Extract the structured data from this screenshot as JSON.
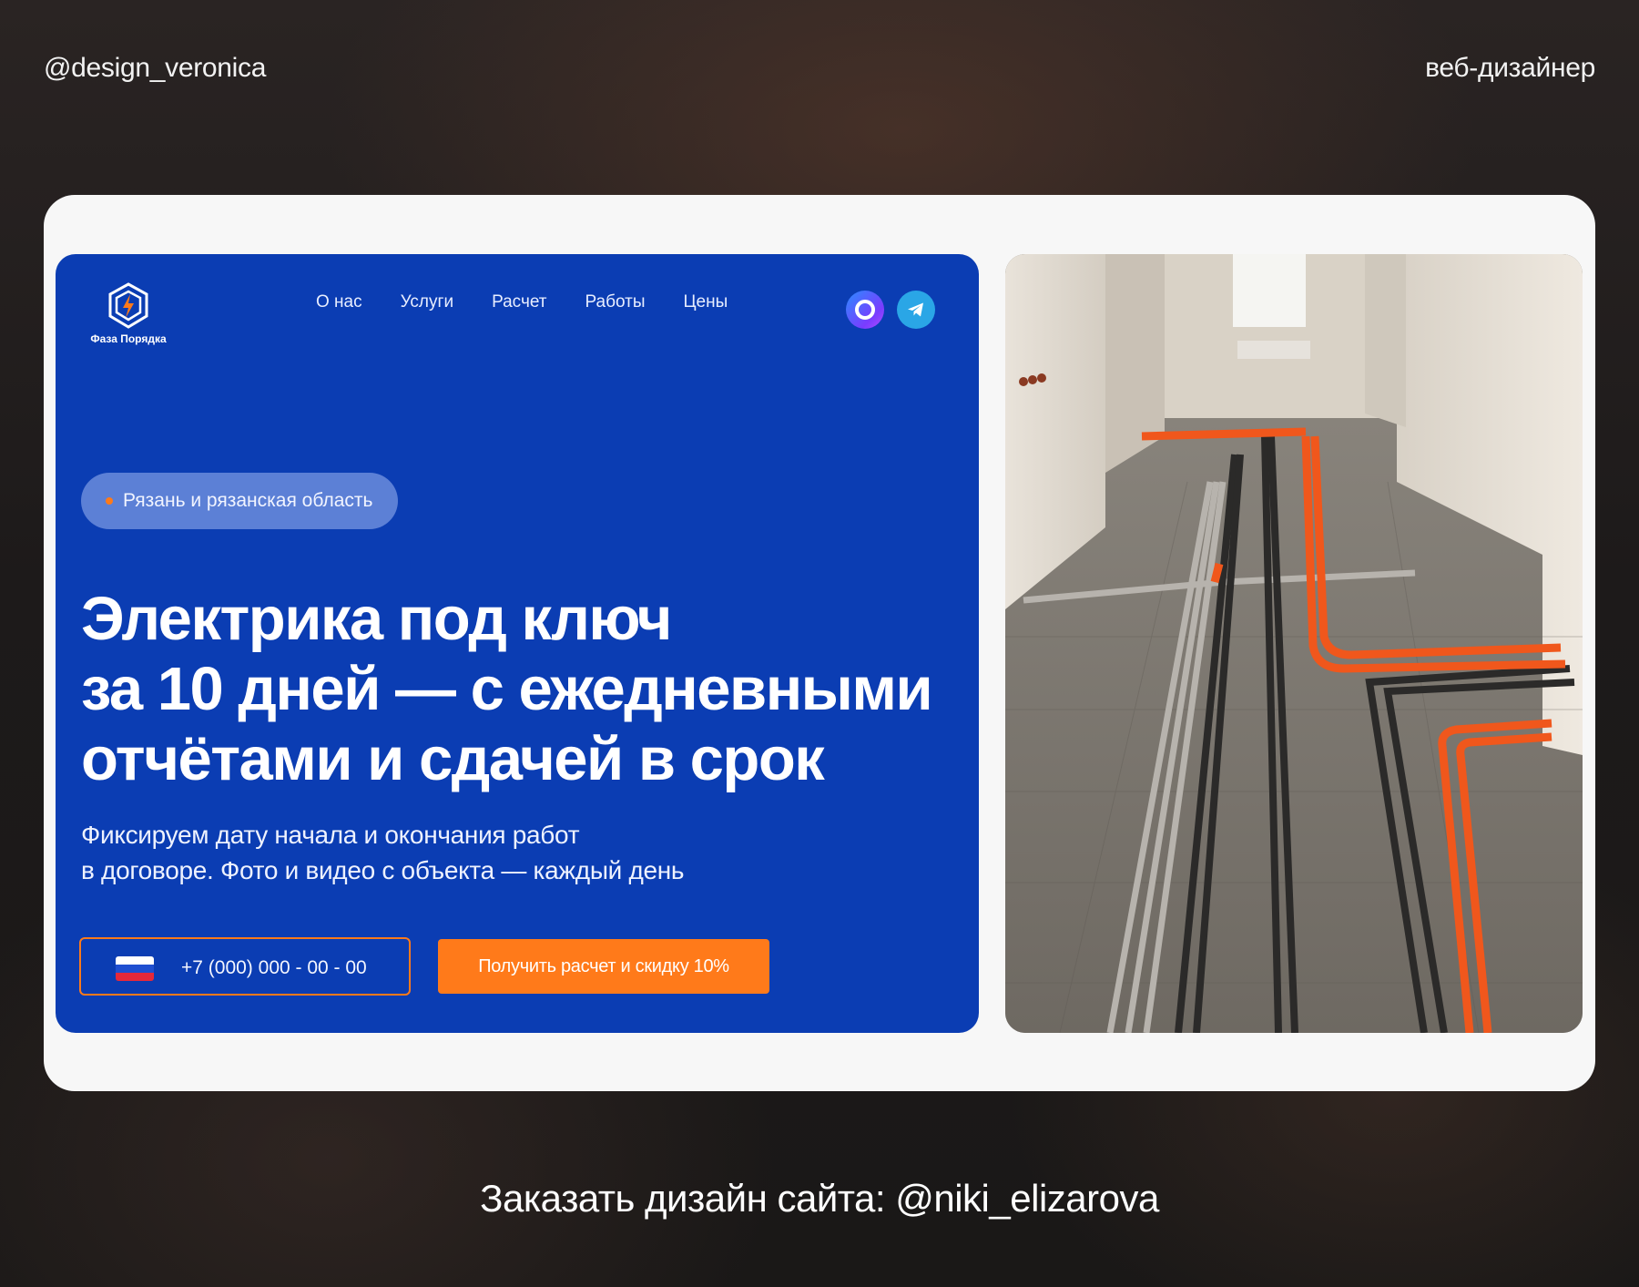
{
  "header": {
    "author_handle": "@design_veronica",
    "role": "веб-дизайнер"
  },
  "site": {
    "logo_text": "Фаза Порядка",
    "nav": [
      "О нас",
      "Услуги",
      "Расчет",
      "Работы",
      "Цены"
    ],
    "socials": [
      "max-messenger-icon",
      "telegram-icon"
    ],
    "region": "Рязань и рязанская область",
    "headline_lines": [
      "Электрика под ключ",
      "за 10 дней — с ежедневными",
      "отчётами и сдачей в срок"
    ],
    "subheadline_lines": [
      "Фиксируем дату начала и окончания работ",
      "в договоре. Фото и видео с объекта — каждый день"
    ],
    "phone_placeholder": "+7 (000) 000 - 00 - 00",
    "cta_label": "Получить расчет и скидку 10%",
    "colors": {
      "hero_bg": "#0b3db3",
      "accent": "#ff7a1a",
      "pill_bg": "#5c80d6",
      "card_bg": "#f7f7f7"
    }
  },
  "footer": {
    "order_text": "Заказать дизайн сайта: @niki_elizarova"
  }
}
